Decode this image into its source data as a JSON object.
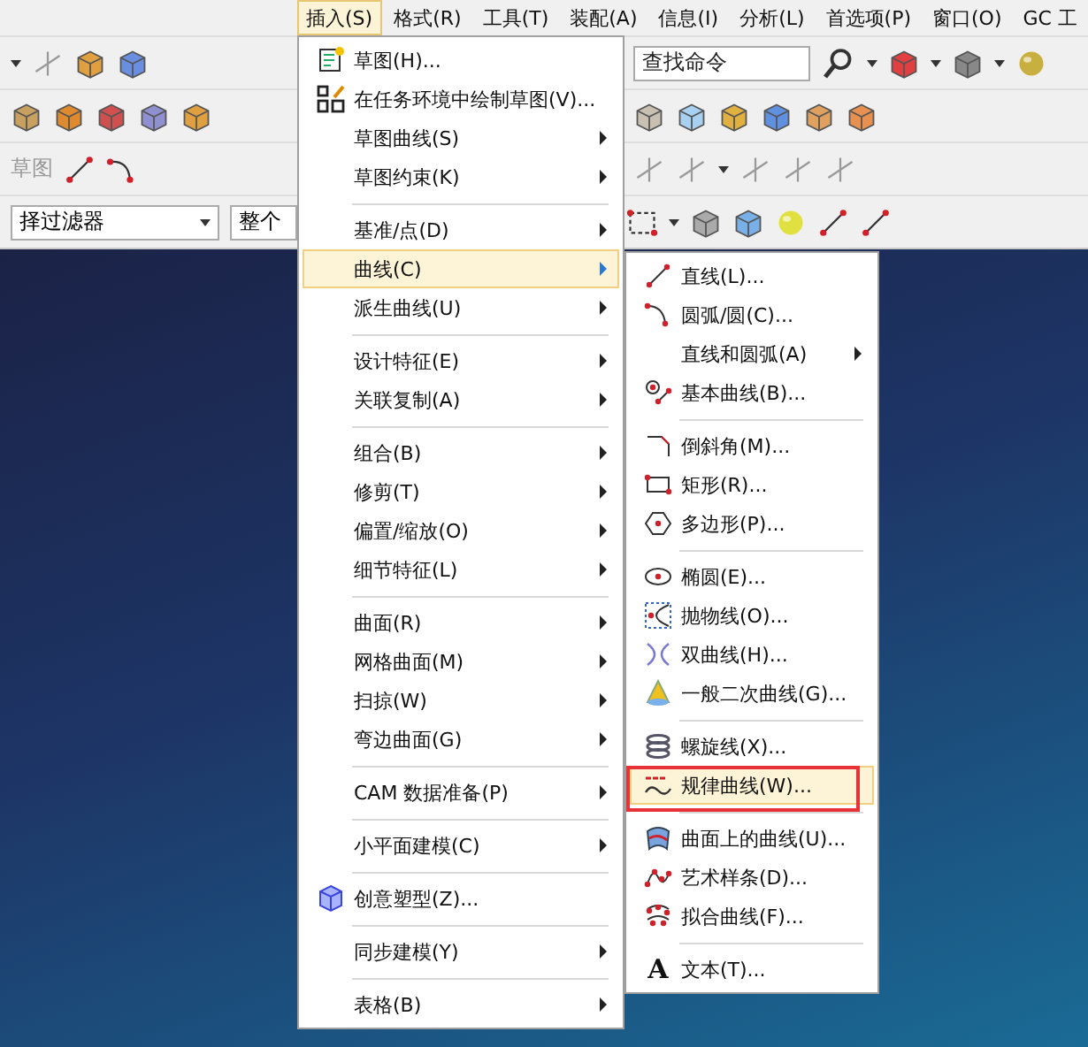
{
  "menu_bar": [
    {
      "label": "插入(S)",
      "selected": true
    },
    {
      "label": "格式(R)",
      "selected": false
    },
    {
      "label": "工具(T)",
      "selected": false
    },
    {
      "label": "装配(A)",
      "selected": false
    },
    {
      "label": "信息(I)",
      "selected": false
    },
    {
      "label": "分析(L)",
      "selected": false
    },
    {
      "label": "首选项(P)",
      "selected": false
    },
    {
      "label": "窗口(O)",
      "selected": false
    },
    {
      "label": "GC 工",
      "selected": false
    }
  ],
  "toolbar": {
    "search": {
      "placeholder": "查找命令"
    },
    "sketch_label": "草图",
    "filter_dropdown": {
      "value": "择过滤器"
    },
    "scope_dropdown": {
      "value": "整个"
    }
  },
  "insert_menu": [
    {
      "kind": "command",
      "label": "草图(H)...",
      "selected": false
    },
    {
      "kind": "command",
      "label": "在任务环境中绘制草图(V)...",
      "selected": false
    },
    {
      "kind": "submenu",
      "label": "草图曲线(S)",
      "selected": false
    },
    {
      "kind": "submenu",
      "label": "草图约束(K)",
      "selected": false
    },
    {
      "kind": "separator"
    },
    {
      "kind": "submenu",
      "label": "基准/点(D)",
      "selected": false
    },
    {
      "kind": "submenu",
      "label": "曲线(C)",
      "selected": true
    },
    {
      "kind": "submenu",
      "label": "派生曲线(U)",
      "selected": false
    },
    {
      "kind": "separator"
    },
    {
      "kind": "submenu",
      "label": "设计特征(E)",
      "selected": false
    },
    {
      "kind": "submenu",
      "label": "关联复制(A)",
      "selected": false
    },
    {
      "kind": "separator"
    },
    {
      "kind": "submenu",
      "label": "组合(B)",
      "selected": false
    },
    {
      "kind": "submenu",
      "label": "修剪(T)",
      "selected": false
    },
    {
      "kind": "submenu",
      "label": "偏置/缩放(O)",
      "selected": false
    },
    {
      "kind": "submenu",
      "label": "细节特征(L)",
      "selected": false
    },
    {
      "kind": "separator"
    },
    {
      "kind": "submenu",
      "label": "曲面(R)",
      "selected": false
    },
    {
      "kind": "submenu",
      "label": "网格曲面(M)",
      "selected": false
    },
    {
      "kind": "submenu",
      "label": "扫掠(W)",
      "selected": false
    },
    {
      "kind": "submenu",
      "label": "弯边曲面(G)",
      "selected": false
    },
    {
      "kind": "separator"
    },
    {
      "kind": "submenu",
      "label": "CAM 数据准备(P)",
      "selected": false
    },
    {
      "kind": "separator"
    },
    {
      "kind": "submenu",
      "label": "小平面建模(C)",
      "selected": false
    },
    {
      "kind": "separator"
    },
    {
      "kind": "command",
      "label": "创意塑型(Z)...",
      "selected": false
    },
    {
      "kind": "separator"
    },
    {
      "kind": "submenu",
      "label": "同步建模(Y)",
      "selected": false
    },
    {
      "kind": "separator"
    },
    {
      "kind": "submenu",
      "label": "表格(B)",
      "selected": false
    }
  ],
  "curve_menu": [
    {
      "kind": "command",
      "label": "直线(L)...",
      "selected": false
    },
    {
      "kind": "command",
      "label": "圆弧/圆(C)...",
      "selected": false
    },
    {
      "kind": "submenu",
      "label": "直线和圆弧(A)",
      "selected": false
    },
    {
      "kind": "command",
      "label": "基本曲线(B)...",
      "selected": false
    },
    {
      "kind": "separator"
    },
    {
      "kind": "command",
      "label": "倒斜角(M)...",
      "selected": false
    },
    {
      "kind": "command",
      "label": "矩形(R)...",
      "selected": false
    },
    {
      "kind": "command",
      "label": "多边形(P)...",
      "selected": false
    },
    {
      "kind": "separator"
    },
    {
      "kind": "command",
      "label": "椭圆(E)...",
      "selected": false
    },
    {
      "kind": "command",
      "label": "抛物线(O)...",
      "selected": false
    },
    {
      "kind": "command",
      "label": "双曲线(H)...",
      "selected": false
    },
    {
      "kind": "command",
      "label": "一般二次曲线(G)...",
      "selected": false
    },
    {
      "kind": "separator"
    },
    {
      "kind": "command",
      "label": "螺旋线(X)...",
      "selected": false
    },
    {
      "kind": "command",
      "label": "规律曲线(W)...",
      "selected": true,
      "annotated": true
    },
    {
      "kind": "separator"
    },
    {
      "kind": "command",
      "label": "曲面上的曲线(U)...",
      "selected": false
    },
    {
      "kind": "command",
      "label": "艺术样条(D)...",
      "selected": false
    },
    {
      "kind": "command",
      "label": "拟合曲线(F)...",
      "selected": false
    },
    {
      "kind": "separator"
    },
    {
      "kind": "command",
      "label": "文本(T)...",
      "selected": false,
      "icon_text": "A"
    }
  ]
}
